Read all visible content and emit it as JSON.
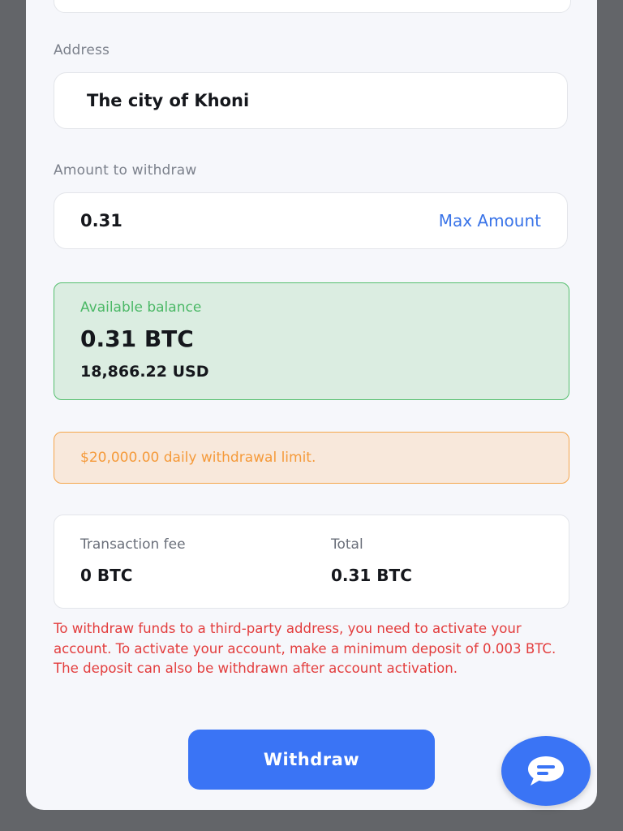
{
  "address": {
    "label": "Address",
    "value": "The city of Khoni"
  },
  "amount": {
    "label": "Amount to withdraw",
    "value": "0.31",
    "max_label": "Max Amount"
  },
  "balance": {
    "label": "Available balance",
    "btc": "0.31 BTC",
    "usd": "18,866.22 USD"
  },
  "limit": {
    "text": "$20,000.00 daily withdrawal limit."
  },
  "fees": {
    "fee_label": "Transaction fee",
    "fee_value": "0 BTC",
    "total_label": "Total",
    "total_value": "0.31 BTC"
  },
  "warning": "To withdraw funds to a third-party address, you need to activate your account. To activate your account, make a minimum deposit of 0.003 BTC. The deposit can also be withdrawn after account activation.",
  "withdraw_label": "Withdraw",
  "icons": {
    "chat": "chat-bubble-icon"
  },
  "colors": {
    "accent": "#3a74f5",
    "success": "#55bf6e",
    "warning": "#f5a64c",
    "error": "#e33d3d"
  }
}
